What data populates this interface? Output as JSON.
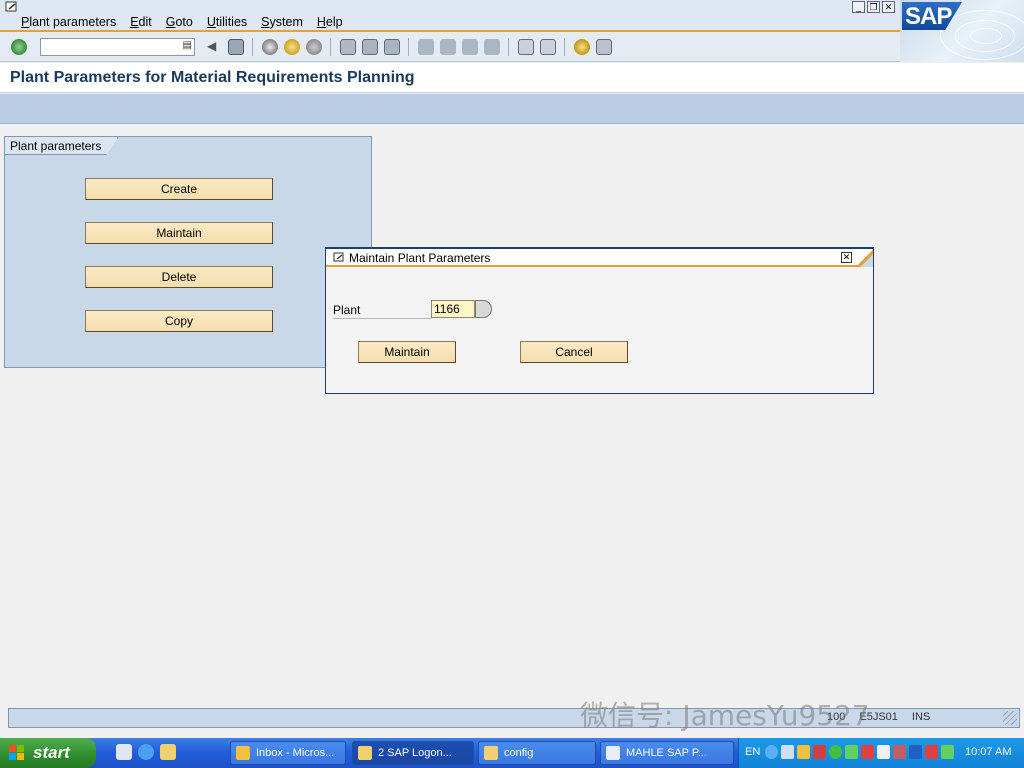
{
  "menu": {
    "items": [
      "Plant parameters",
      "Edit",
      "Goto",
      "Utilities",
      "System",
      "Help"
    ]
  },
  "window_controls": {
    "minimize": "_",
    "restore": "❐",
    "close": "✕"
  },
  "brand": {
    "logo": "SAP"
  },
  "toolbar": {
    "command_field_value": ""
  },
  "page": {
    "title": "Plant Parameters for Material Requirements Planning"
  },
  "group": {
    "title": "Plant parameters",
    "buttons": {
      "create": "Create",
      "maintain": "Maintain",
      "delete": "Delete",
      "copy": "Copy"
    }
  },
  "dialog": {
    "title": "Maintain Plant Parameters",
    "plant_label": "Plant",
    "plant_value": "1166",
    "maintain_label": "Maintain",
    "cancel_label": "Cancel"
  },
  "status": {
    "client": "100",
    "server": "E5JS01",
    "mode": "INS"
  },
  "taskbar": {
    "start_label": "start",
    "tasks": [
      "Inbox - Micros...",
      "2 SAP Logon...",
      "config",
      "MAHLE SAP P..."
    ],
    "language": "EN",
    "clock": "10:07 AM"
  },
  "watermark": "微信号: JamesYu9527",
  "colors": {
    "accent": "#e1a23a",
    "button_face": "#f5deae",
    "group_bg": "#c9d8e8",
    "app_toolbar": "#b8cde4",
    "taskbar": "#245edb",
    "start": "#2e8b2e"
  }
}
